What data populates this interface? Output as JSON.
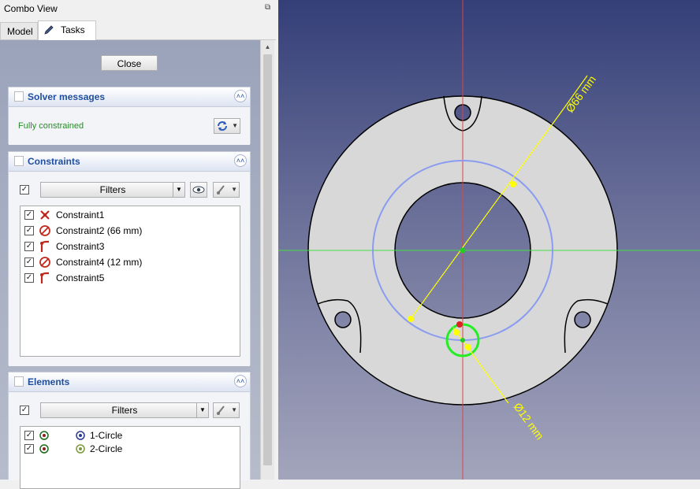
{
  "combo_view": {
    "title": "Combo View",
    "tabs": [
      {
        "label": "Model",
        "active": false
      },
      {
        "label": "Tasks",
        "active": true
      }
    ]
  },
  "task_panel": {
    "close_label": "Close",
    "solver": {
      "title": "Solver messages",
      "status": "Fully constrained",
      "status_color": "#2a8a2a"
    },
    "constraints": {
      "title": "Constraints",
      "filter_label": "Filters",
      "items": [
        {
          "label": "Constraint1",
          "icon": "coincident-icon",
          "checked": true
        },
        {
          "label": "Constraint2 (66 mm)",
          "icon": "diameter-icon",
          "checked": true
        },
        {
          "label": "Constraint3",
          "icon": "point-on-object-icon",
          "checked": true
        },
        {
          "label": "Constraint4 (12 mm)",
          "icon": "diameter-icon",
          "checked": true
        },
        {
          "label": "Constraint5",
          "icon": "point-on-object-icon",
          "checked": true
        }
      ]
    },
    "elements": {
      "title": "Elements",
      "filter_label": "Filters",
      "items": [
        {
          "label": "1-Circle",
          "checked": true
        },
        {
          "label": "2-Circle",
          "checked": true
        }
      ]
    }
  },
  "viewport": {
    "dimensions": [
      {
        "label": "Ø66 mm"
      },
      {
        "label": "Ø12 mm"
      }
    ],
    "colors": {
      "background_top": "#343f78",
      "background_bottom": "#a3a5bc",
      "axis_x": "#44dd44",
      "axis_y": "#dd4444",
      "construction_circle": "#8a9cf0",
      "selected_circle": "#22ee22",
      "dimension": "#ffff00"
    }
  }
}
